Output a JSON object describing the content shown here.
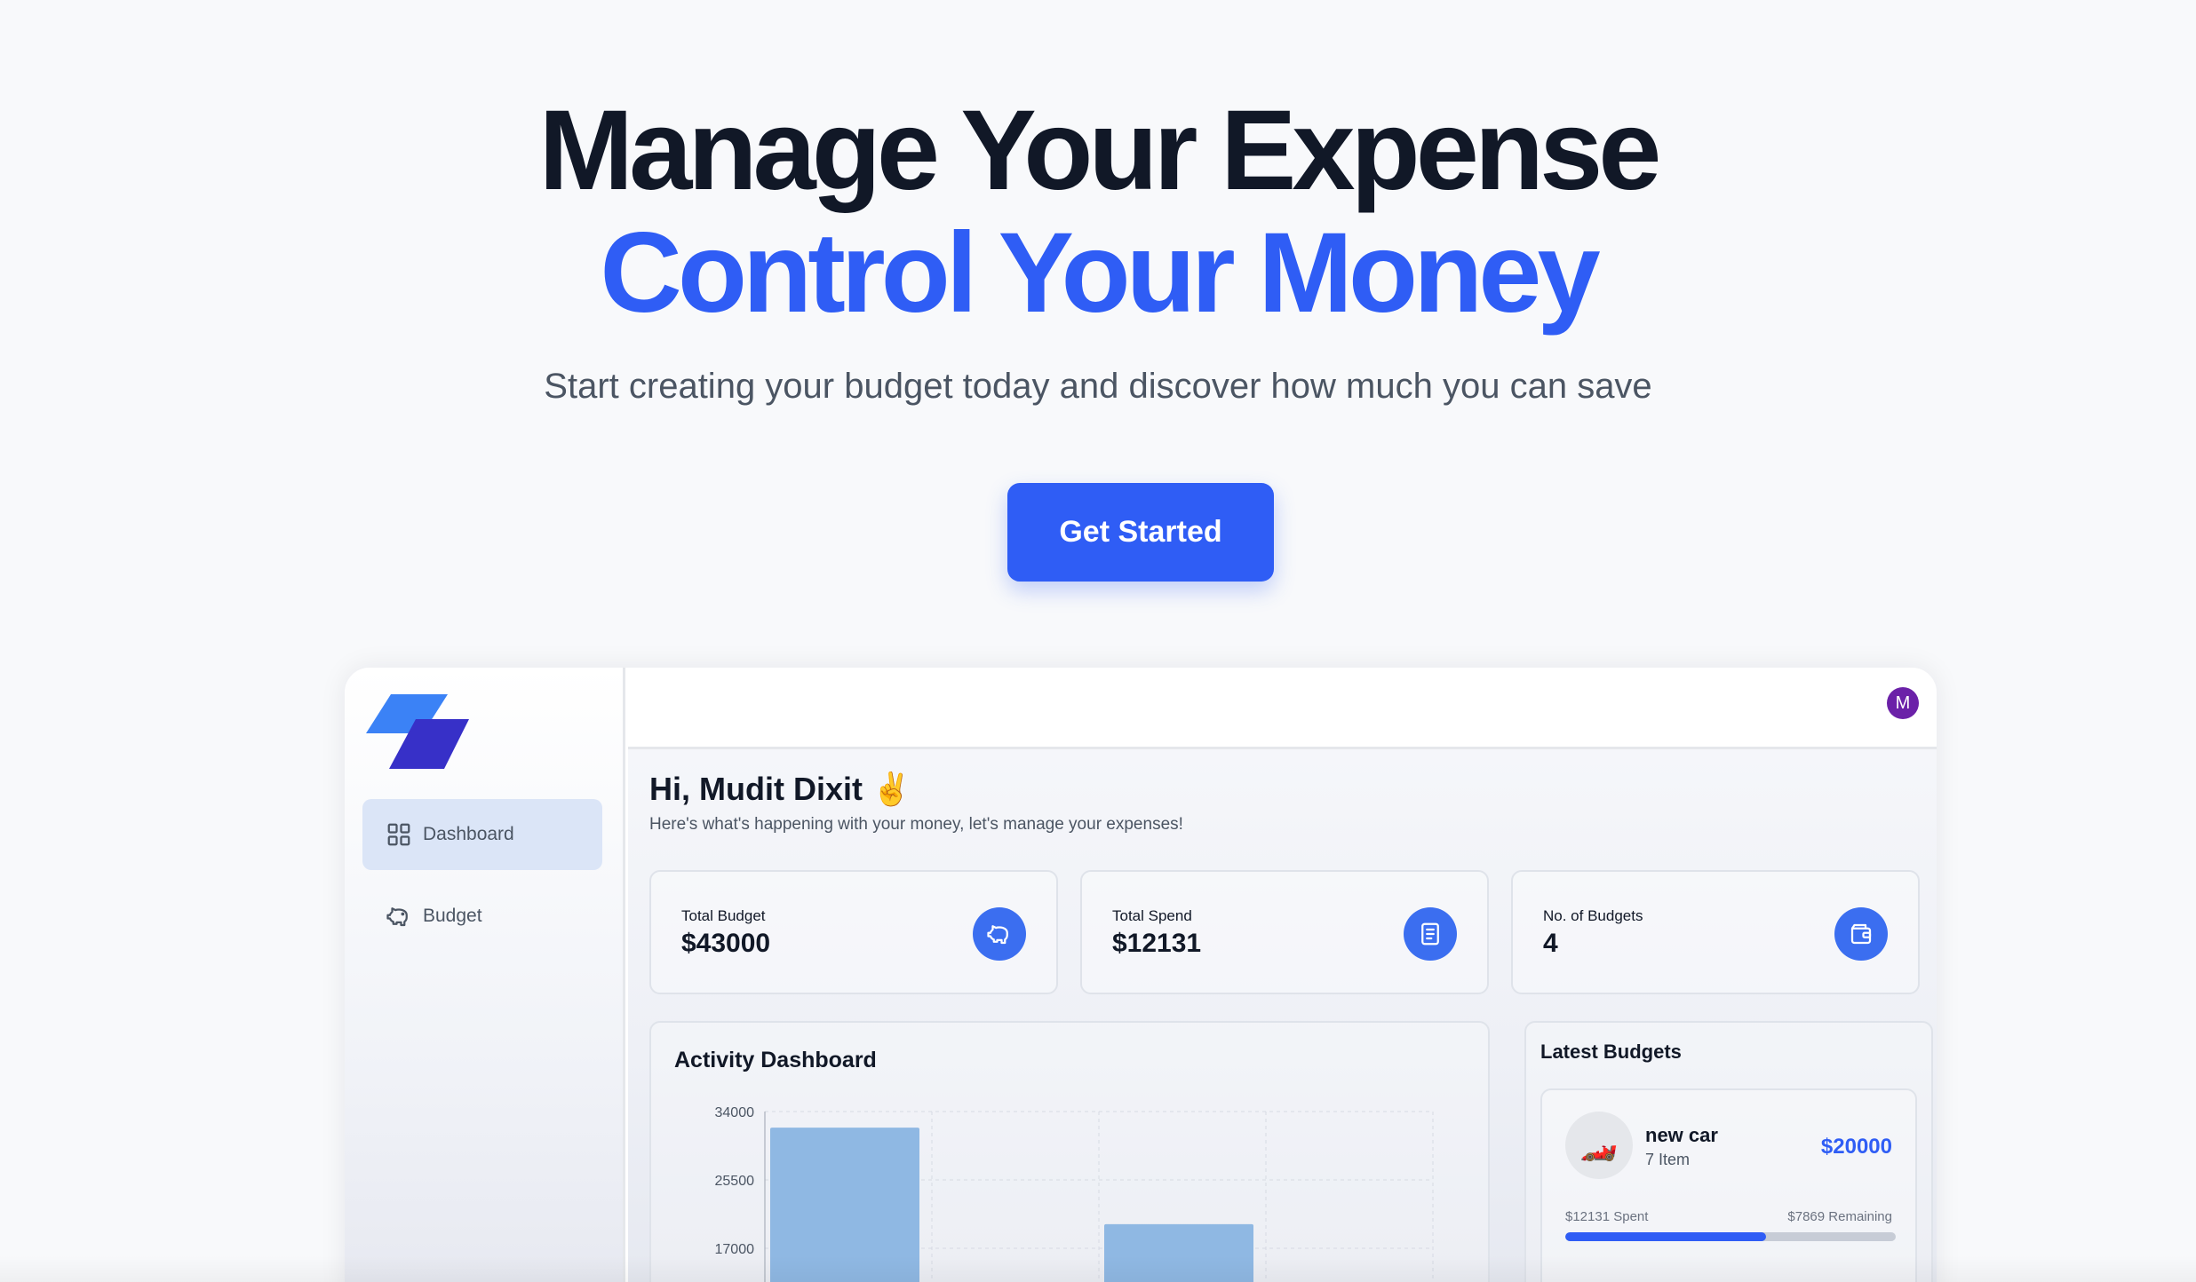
{
  "hero": {
    "title_line1": "Manage Your Expense",
    "title_line2": "Control Your Money",
    "subtitle": "Start creating your budget today and discover how much you can save",
    "cta_label": "Get Started"
  },
  "sidebar": {
    "items": [
      {
        "label": "Dashboard",
        "icon": "grid-icon",
        "active": true
      },
      {
        "label": "Budget",
        "icon": "piggy-bank-icon",
        "active": false
      }
    ]
  },
  "topbar": {
    "avatar_initial": "M"
  },
  "greeting": {
    "title": "Hi, Mudit Dixit ✌️",
    "subtitle": "Here's what's happening with your money, let's manage your expenses!"
  },
  "stats": [
    {
      "label": "Total Budget",
      "value": "$43000",
      "icon": "piggy-bank-icon"
    },
    {
      "label": "Total Spend",
      "value": "$12131",
      "icon": "receipt-icon"
    },
    {
      "label": "No. of Budgets",
      "value": "4",
      "icon": "wallet-icon"
    }
  ],
  "activity": {
    "title": "Activity Dashboard"
  },
  "chart_data": {
    "type": "bar",
    "title": "Activity Dashboard",
    "y_ticks": [
      "34000",
      "25500",
      "17000"
    ],
    "ylim": [
      0,
      34000
    ],
    "series": [
      {
        "values": [
          32000,
          20000
        ],
        "color": "#8fb8e3"
      }
    ],
    "grid": true
  },
  "latest": {
    "title": "Latest Budgets",
    "items": [
      {
        "emoji": "🏎️",
        "name": "new car",
        "count": "7 Item",
        "amount": "$20000",
        "spent": "$12131 Spent",
        "remaining": "$7869 Remaining",
        "progress": 0.607
      }
    ]
  },
  "colors": {
    "brand": "#2f5df5",
    "icon_bg": "#3b6ef0",
    "bar": "#8fb8e3",
    "avatar": "#6b21a8"
  }
}
